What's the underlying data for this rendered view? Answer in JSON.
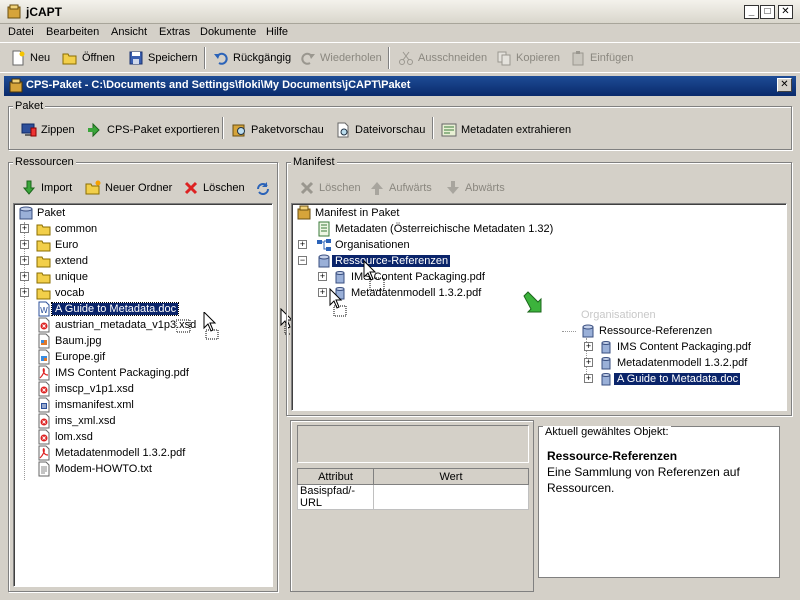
{
  "window": {
    "title": "jCAPT",
    "buttons": [
      "_",
      "□",
      "✕"
    ]
  },
  "menu": [
    "Datei",
    "Bearbeiten",
    "Ansicht",
    "Extras",
    "Dokumente",
    "Hilfe"
  ],
  "toolbar": {
    "new": "Neu",
    "open": "Öffnen",
    "save": "Speichern",
    "undo": "Rückgängig",
    "redo": "Wiederholen",
    "cut": "Ausschneiden",
    "copy": "Kopieren",
    "paste": "Einfügen"
  },
  "document": {
    "title": "CPS-Paket - C:\\Documents and Settings\\floki\\My Documents\\jCAPT\\Paket",
    "close": "✕"
  },
  "paket_group": {
    "title": "Paket",
    "buttons": {
      "zip": "Zippen",
      "export": "CPS-Paket exportieren",
      "preview_package": "Paketvorschau",
      "preview_file": "Dateivorschau",
      "extract": "Metadaten extrahieren"
    }
  },
  "resources": {
    "title": "Ressourcen",
    "buttons": {
      "import": "Import",
      "new_folder": "Neuer Ordner",
      "delete": "Löschen"
    },
    "tree": {
      "root": "Paket",
      "folders": [
        "common",
        "Euro",
        "extend",
        "unique",
        "vocab"
      ],
      "files": [
        "A Guide to Metadata.doc",
        "austrian_metadata_v1p3.xsd",
        "Baum.jpg",
        "Europe.gif",
        "IMS Content Packaging.pdf",
        "imscp_v1p1.xsd",
        "imsmanifest.xml",
        "ims_xml.xsd",
        "lom.xsd",
        "Metadatenmodell 1.3.2.pdf",
        "Modem-HOWTO.txt"
      ]
    }
  },
  "manifest": {
    "title": "Manifest",
    "buttons": {
      "delete": "Löschen",
      "up": "Aufwärts",
      "down": "Abwärts"
    },
    "tree": {
      "root": "Manifest in Paket",
      "metadata": "Metadaten (Österreichische Metadaten 1.32)",
      "organisations": "Organisationen",
      "resources": "Ressource-Referenzen",
      "children": [
        "IMS Content Packaging.pdf",
        "Metadatenmodell 1.3.2.pdf"
      ]
    },
    "after": {
      "faded": "Organisationen",
      "resources": "Ressource-Referenzen",
      "children": [
        "IMS Content Packaging.pdf",
        "Metadatenmodell 1.3.2.pdf",
        "A Guide to Metadata.doc"
      ]
    }
  },
  "attributes": {
    "headers": [
      "Attribut",
      "Wert"
    ],
    "rows": [
      [
        "Basispfad/-URL",
        ""
      ]
    ]
  },
  "selected": {
    "title": "Aktuell gewähltes Objekt:",
    "name": "Ressource-Referenzen",
    "description": "Eine Sammlung von Referenzen auf Ressourcen."
  }
}
